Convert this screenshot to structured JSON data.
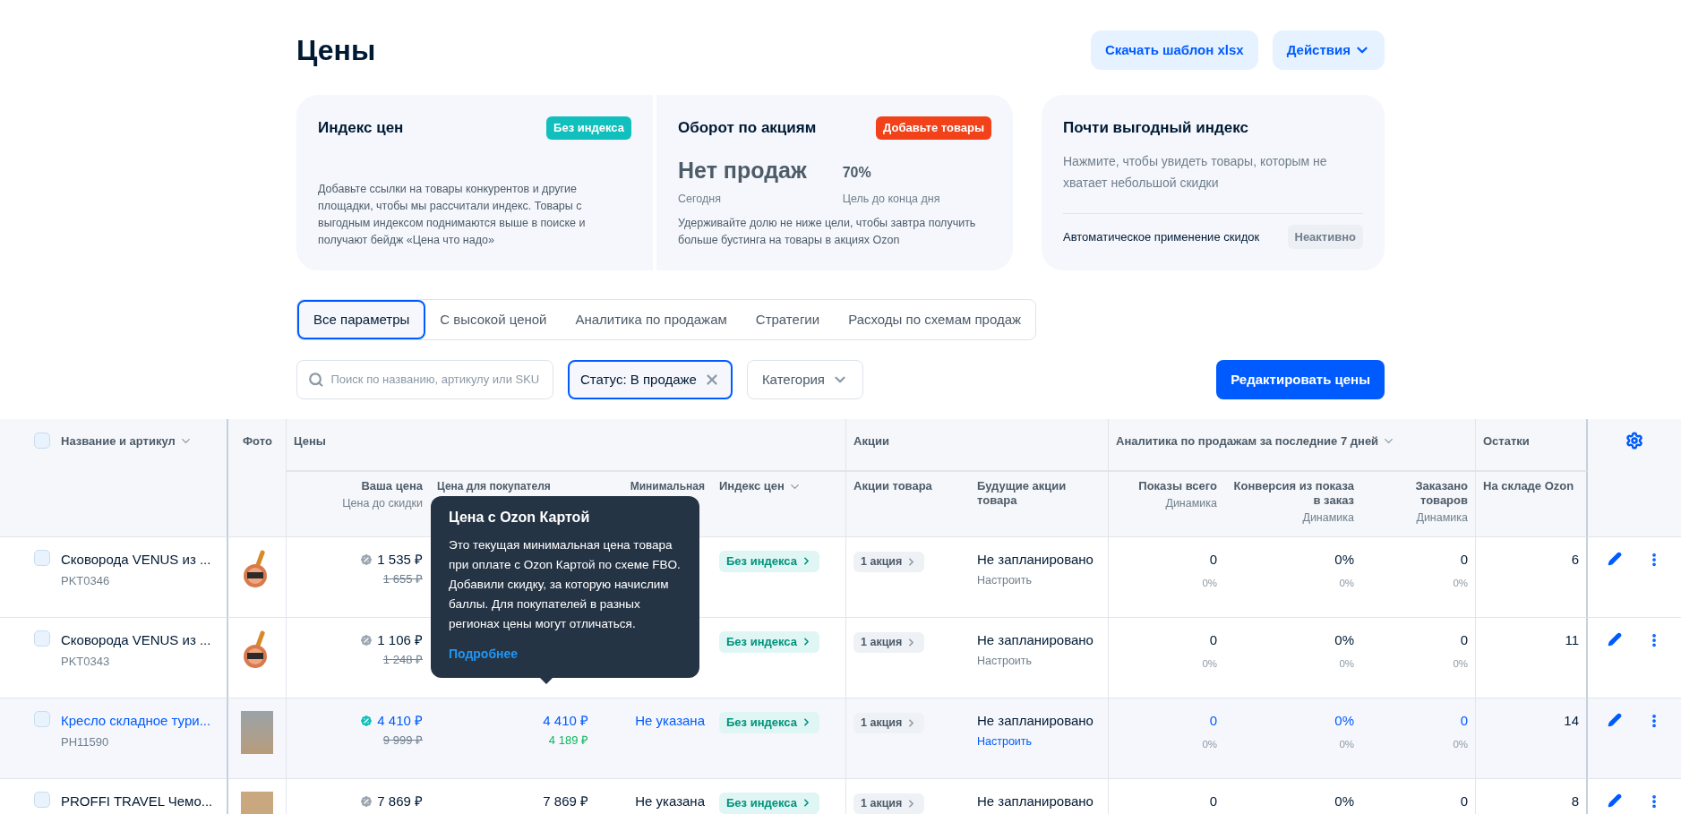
{
  "page_title": "Цены",
  "header_buttons": [
    {
      "label": "Скачать шаблон xlsx",
      "has_caret": false
    },
    {
      "label": "Действия",
      "has_caret": true
    }
  ],
  "cards": {
    "price_index": {
      "title": "Индекс цен",
      "badge": "Без индекса",
      "text": "Добавьте ссылки на товары конкурентов и другие площадки, чтобы мы рассчитали индекс. Товары с выгодным индексом поднимаются выше в поиске и получают бейдж «Цена что надо»"
    },
    "promo_turnover": {
      "title": "Оборот по акциям",
      "badge": "Добавьте товары",
      "value": "Нет продаж",
      "value_caption": "Сегодня",
      "goal": "70%",
      "goal_caption": "Цель до конца дня",
      "text": "Удерживайте долю не ниже цели, чтобы завтра получить больше бустинга на товары в акциях Ozon"
    },
    "almost_index": {
      "title": "Почти выгодный индекс",
      "text": "Нажмите, чтобы увидеть товары, которым не хватает небольшой скидки",
      "auto_label": "Автоматическое применение скидок",
      "auto_status": "Неактивно"
    }
  },
  "tabs": [
    {
      "label": "Все параметры",
      "selected": true
    },
    {
      "label": "С высокой ценой",
      "selected": false
    },
    {
      "label": "Аналитика по продажам",
      "selected": false
    },
    {
      "label": "Стратегии",
      "selected": false
    },
    {
      "label": "Расходы по схемам продаж",
      "selected": false
    }
  ],
  "search": {
    "placeholder": "Поиск по названию, артикулу или SKU"
  },
  "status_filter": {
    "label": "Статус: В продаже"
  },
  "category_filter": {
    "label": "Категория"
  },
  "edit_button": "Редактировать цены",
  "table": {
    "header_checkbox": {
      "checked": false
    },
    "groups": [
      "Название и артикул",
      "Фото",
      "Цены",
      "Акции",
      "Аналитика по продажам за последние 7 дней",
      "Остатки"
    ],
    "columns": [
      {
        "title": "Ваша цена",
        "subtitle": "Цена до скидки"
      },
      {
        "title": "Цена для покупателя"
      },
      {
        "title": "Минимальная"
      },
      {
        "title": "Индекс цен"
      },
      {
        "title": "Акции товара"
      },
      {
        "title": "Будущие акции товара"
      },
      {
        "title": "Показы всего",
        "subtitle": "Динамика"
      },
      {
        "title": "Конверсия из показа в заказ",
        "subtitle": "Динамика"
      },
      {
        "title": "Заказано товаров",
        "subtitle": "Динамика"
      },
      {
        "title": "На складе Ozon"
      }
    ],
    "rows": [
      {
        "checked": false,
        "highlighted": false,
        "name": "Сковорода VENUS из ...",
        "sku": "PKT0346",
        "photo": {
          "kind": "pan"
        },
        "your_price": "1 535 ₽",
        "old_price": "1 655 ₽",
        "discount_active": false,
        "index": "Без индекса",
        "promo": "1 акция",
        "future": "Не запланировано",
        "future_link": "Настроить",
        "views": "0",
        "views_dyn": "0%",
        "conv": "0%",
        "conv_dyn": "0%",
        "orders": "0",
        "orders_dyn": "0%",
        "stock": "6"
      },
      {
        "checked": false,
        "highlighted": false,
        "name": "Сковорода VENUS из ...",
        "sku": "PKT0343",
        "photo": {
          "kind": "pan"
        },
        "your_price": "1 106 ₽",
        "old_price": "1 248 ₽",
        "discount_active": false,
        "index": "Без индекса",
        "promo": "1 акция",
        "future": "Не запланировано",
        "future_link": "Настроить",
        "views": "0",
        "views_dyn": "0%",
        "conv": "0%",
        "conv_dyn": "0%",
        "orders": "0",
        "orders_dyn": "0%",
        "stock": "11"
      },
      {
        "checked": false,
        "highlighted": true,
        "name": "Кресло складное тури...",
        "sku": "PH11590",
        "photo": {
          "kind": "chair"
        },
        "your_price": "4 410 ₽",
        "old_price": "9 999 ₽",
        "discount_active": true,
        "buyer_price": "4 410 ₽",
        "card_price": "4 189 ₽",
        "min_price": "Не указана",
        "index": "Без индекса",
        "promo": "1 акция",
        "future": "Не запланировано",
        "future_link": "Настроить",
        "views": "0",
        "views_dyn": "0%",
        "conv": "0%",
        "conv_dyn": "0%",
        "orders": "0",
        "orders_dyn": "0%",
        "stock": "14"
      },
      {
        "checked": false,
        "highlighted": false,
        "name": "PROFFI TRAVEL Чемо...",
        "photo": {
          "kind": "box"
        },
        "your_price": "7 869 ₽",
        "discount_active": false,
        "buyer_price": "7 869 ₽",
        "min_price": "Не указана",
        "index": "Без индекса",
        "promo": "1 акция",
        "future": "Не запланировано",
        "views": "0",
        "conv": "0%",
        "orders": "0",
        "stock": "8"
      }
    ]
  },
  "tooltip": {
    "title": "Цена с Ozon Картой",
    "text": "Это текущая минимальная цена товара при оплате с Ozon Картой по схеме FBO. Добавили скидку, за которую начислим баллы. Для покупателей в разных регионах цены могут отличаться.",
    "link": "Подробнее"
  }
}
